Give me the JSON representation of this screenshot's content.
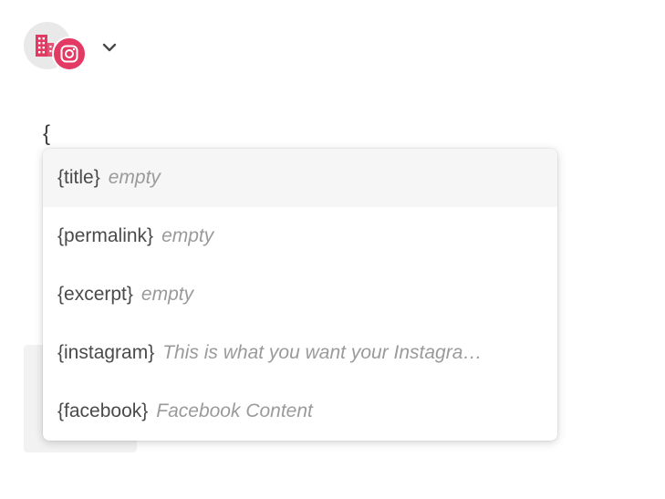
{
  "account": {
    "icons": [
      "building-icon",
      "instagram-icon",
      "chevron-down-icon"
    ],
    "accent_color": "#e33a63"
  },
  "editor": {
    "typed_text": "{"
  },
  "suggestions": [
    {
      "token": "{title}",
      "value": "empty",
      "active": true
    },
    {
      "token": "{permalink}",
      "value": "empty",
      "active": false
    },
    {
      "token": "{excerpt}",
      "value": "empty",
      "active": false
    },
    {
      "token": "{instagram}",
      "value": "This is what you want your Instagra…",
      "active": false
    },
    {
      "token": "{facebook}",
      "value": "Facebook Content",
      "active": false
    }
  ]
}
